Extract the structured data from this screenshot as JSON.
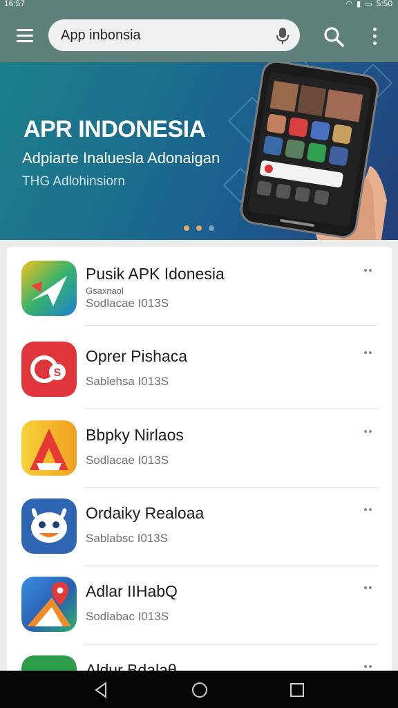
{
  "status_bar": {
    "time_left": "16:57",
    "time_right": "5:50"
  },
  "search": {
    "query": "App inbonsia"
  },
  "banner": {
    "title": "APR INDONESIA",
    "subtitle": "Adpiarte Inaluesla Adonaigan",
    "tagline": "THG Adlohinsiorn",
    "carousel_dots": 3,
    "active_dot_colors": [
      "#e0a66a",
      "#e0a66a",
      "#7fa3b8"
    ]
  },
  "apps": [
    {
      "name": "Pusik APK Idonesia",
      "developer": "Gsaxnaol",
      "meta": "Sodlacae I013S",
      "icon": "maps-arrow-icon"
    },
    {
      "name": "Oprer Pishaca",
      "developer": "",
      "meta": "Sablehsa I013S",
      "icon": "cs-logo-icon"
    },
    {
      "name": "Bbpky Nirlaos",
      "developer": "",
      "meta": "Sodlacae I013S",
      "icon": "letter-a-icon"
    },
    {
      "name": "Ordaiky Realoaa",
      "developer": "",
      "meta": "Sablabsc I013S",
      "icon": "robot-face-icon"
    },
    {
      "name": "Adlar IIHabQ",
      "developer": "",
      "meta": "Sodlabac I013S",
      "icon": "map-pin-icon"
    },
    {
      "name": "Aldur Bdalaθ",
      "developer": "",
      "meta": "",
      "icon": "green-app-icon"
    }
  ],
  "colors": {
    "app_bar": "#5f807a",
    "banner_start": "#1d7f8b",
    "banner_end": "#243f7a",
    "nav_bar": "#050505"
  }
}
